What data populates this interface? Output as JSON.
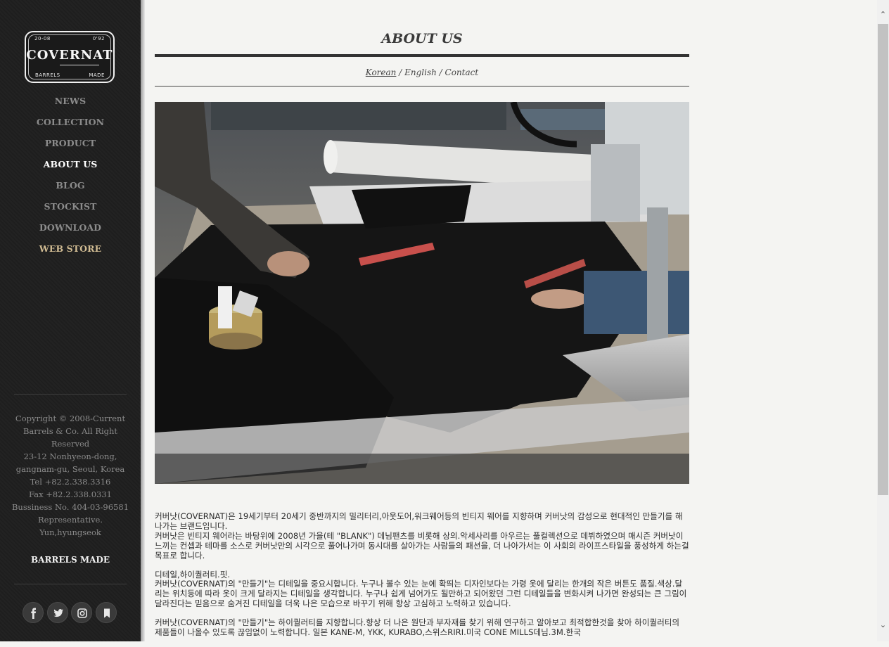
{
  "logo": {
    "top_left": "20-08",
    "top_right": "0'92",
    "name": "COVERNAT",
    "bottom_left": "BARRELS",
    "bottom_right": "MADE"
  },
  "nav": {
    "items": [
      {
        "label": "NEWS"
      },
      {
        "label": "COLLECTION"
      },
      {
        "label": "PRODUCT"
      },
      {
        "label": "ABOUT US",
        "active": true
      },
      {
        "label": "BLOG"
      },
      {
        "label": "STOCKIST"
      },
      {
        "label": "DOWNLOAD"
      },
      {
        "label": "WEB STORE"
      }
    ]
  },
  "footer": {
    "lines": [
      "Copyright © 2008-Current",
      "Barrels & Co. All Right",
      "Reserved",
      "23-12 Nonhyeon-dong,",
      "gangnam-gu, Seoul, Korea",
      "Tel +82.2.338.3316",
      "Fax +82.2.338.0331",
      "Bussiness No. 404-03-96581",
      "Representative.",
      "Yun,hyungseok"
    ],
    "brand": "BARRELS MADE",
    "social_icons": [
      "facebook-icon",
      "twitter-icon",
      "instagram-icon",
      "bookmark-icon"
    ]
  },
  "main": {
    "title": "ABOUT US",
    "languages": {
      "korean": "Korean",
      "english": "English",
      "contact": "Contact",
      "separator": "/"
    },
    "paragraphs": [
      "커버낫(COVERNAT)은 19세기부터 20세기 중반까지의 밀리터리,아웃도어,워크웨어등의 빈티지 웨어를 지향하며 커버낫의 감성으로 현대적인 만들기를 해나가는 브랜드입니다.\n커버낫은 빈티지 웨어라는 바탕위에 2008년 가을(테 \"BLANK\") 데님팬츠를 비롯해 상의.악세사리를 아우르는 풀컬렉션으로 데뷔하였으며 매시즌 커버낫이 느끼는 컨셉과 테마를 소스로 커버낫만의 시각으로 풀어나가며 동시대를 살아가는 사람들의 패션을, 더 나아가서는 이 사회의 라이프스타일을 풍성하게 하는걸 목표로 합니다.",
      "디테일,하이퀄러티.핏.\n커버낫(COVERNAT)의 \"만들기\"는 디테일을 중요시합니다. 누구나 볼수 있는 눈에 확띄는 디자인보다는 가령 옷에 달리는 한개의 작은 버튼도 품질.색상.달리는 위치등에 따라 옷이 크게 달라지는 디테일을 생각합니다. 누구나 쉽게 넘어가도 될만하고 되어왔던 그런 디테일들을 변화시켜 나가면 완성되는 큰 그림이 달라진다는 믿음으로 숨겨진 디테일을 더욱 나은 모습으로 바꾸기 위해 항상 고심하고 노력하고 있습니다.",
      "커버낫(COVERNAT)의 \"만들기\"는 하이퀄러티를 지향합니다.향상 더 나은 원단과 부자재를 찾기 위해 연구하고 알아보고 최적합한것을 찾아 하이퀄러티의 제품들이 나올수 있도록 끊임없이 노력합니다. 일본 KANE-M, YKK, KURABO,스위스RIRI.미국 CONE MILLS데님.3M.한국"
    ]
  },
  "colors": {
    "sidebar_bg": "#1f1f1f",
    "nav_inactive": "#8c8c8c",
    "nav_active": "#ffffff",
    "web_store": "#d1bc93",
    "page_bg": "#f4f4f2"
  }
}
